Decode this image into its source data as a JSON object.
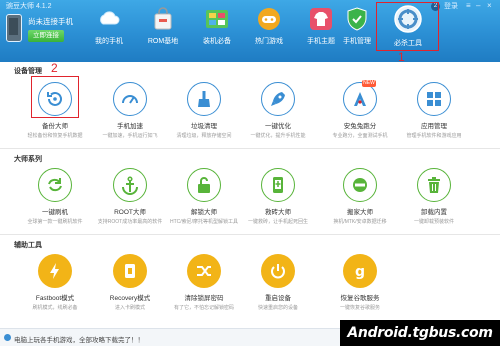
{
  "app": {
    "brand": "豌豆大师 4.1.2",
    "connect_title": "尚未连接手机",
    "connect_button": "立即连接",
    "nav": [
      {
        "label": "我的手机",
        "icon": "cloud-icon",
        "color": "#4fb3ea"
      },
      {
        "label": "ROM基地",
        "icon": "shopping-bag-icon",
        "color": "#f0f0f0"
      },
      {
        "label": "装机必备",
        "icon": "apps-grid-icon",
        "color": "#57c45a"
      },
      {
        "label": "热门游戏",
        "icon": "gamepad-icon",
        "color": "#f2a81e"
      },
      {
        "label": "手机主题",
        "icon": "tshirt-icon",
        "color": "#e8506a"
      },
      {
        "label": "手机管理",
        "icon": "shield-icon",
        "color": "#3bb34a"
      },
      {
        "label": "必杀工具",
        "icon": "toolbox-icon",
        "color": "#4a8fc9"
      }
    ],
    "window": {
      "badge": "2",
      "login": "登录"
    },
    "annotations": {
      "one": "1",
      "two": "2"
    }
  },
  "sections": {
    "device": {
      "title": "设备管理",
      "tiles": [
        {
          "name": "备份大师",
          "desc": "轻松备份和恢复手机数据",
          "icon": "backup-icon"
        },
        {
          "name": "手机加速",
          "desc": "一键加速，手机运行如飞",
          "icon": "speedometer-icon"
        },
        {
          "name": "垃圾清理",
          "desc": "清理垃圾，释放存储空间",
          "icon": "broom-icon"
        },
        {
          "name": "一键优化",
          "desc": "一键优化，提升手机性能",
          "icon": "rocket-icon"
        },
        {
          "name": "安兔兔跑分",
          "desc": "专业跑分，全面测试手机",
          "icon": "antutu-icon",
          "tag": "NEW"
        },
        {
          "name": "应用管理",
          "desc": "管理手机软件和游戏应用",
          "icon": "app-manager-icon"
        }
      ]
    },
    "master": {
      "title": "大师系列",
      "tiles": [
        {
          "name": "一键刷机",
          "desc": "全球第一款一键刷机软件",
          "icon": "refresh-icon"
        },
        {
          "name": "ROOT大师",
          "desc": "支持ROOT成功率最高的软件",
          "icon": "anchor-icon"
        },
        {
          "name": "解锁大师",
          "desc": "HTC/索尼/摩托等机型解锁工具",
          "icon": "unlock-icon"
        },
        {
          "name": "救砖大师",
          "desc": "一键救砖，让手机起死回生",
          "icon": "phone-rescue-icon"
        },
        {
          "name": "搬家大师",
          "desc": "换机/MTK/安卓数据迁移",
          "icon": "move-icon"
        },
        {
          "name": "卸载内置",
          "desc": "一键卸载预装软件",
          "icon": "trash-icon"
        }
      ]
    },
    "aux": {
      "title": "辅助工具",
      "tiles": [
        {
          "name": "Fastboot模式",
          "desc": "刷机模式，线刷必备",
          "icon": "lightning-icon"
        },
        {
          "name": "Recovery模式",
          "desc": "进入卡刷模式",
          "icon": "recovery-icon"
        },
        {
          "name": "清除锁屏密码",
          "desc": "有了它，不怕忘记解锁密码",
          "icon": "shuffle-icon"
        },
        {
          "name": "重启设备",
          "desc": "快速重启您的设备",
          "icon": "power-icon"
        },
        {
          "name": "恢复谷歌服务",
          "desc": "一键恢复谷歌服务",
          "icon": "google-icon"
        }
      ]
    }
  },
  "footer": {
    "text": "电脑上玩各手机游戏，全部攻略下载完了！！",
    "watermark": "Android.tgbus.com"
  },
  "colors": {
    "header": "#2b8fd4",
    "accent_blue": "#3a8ed3",
    "accent_green": "#58b43a",
    "accent_yellow": "#f2b417",
    "highlight": "#e0242d"
  }
}
